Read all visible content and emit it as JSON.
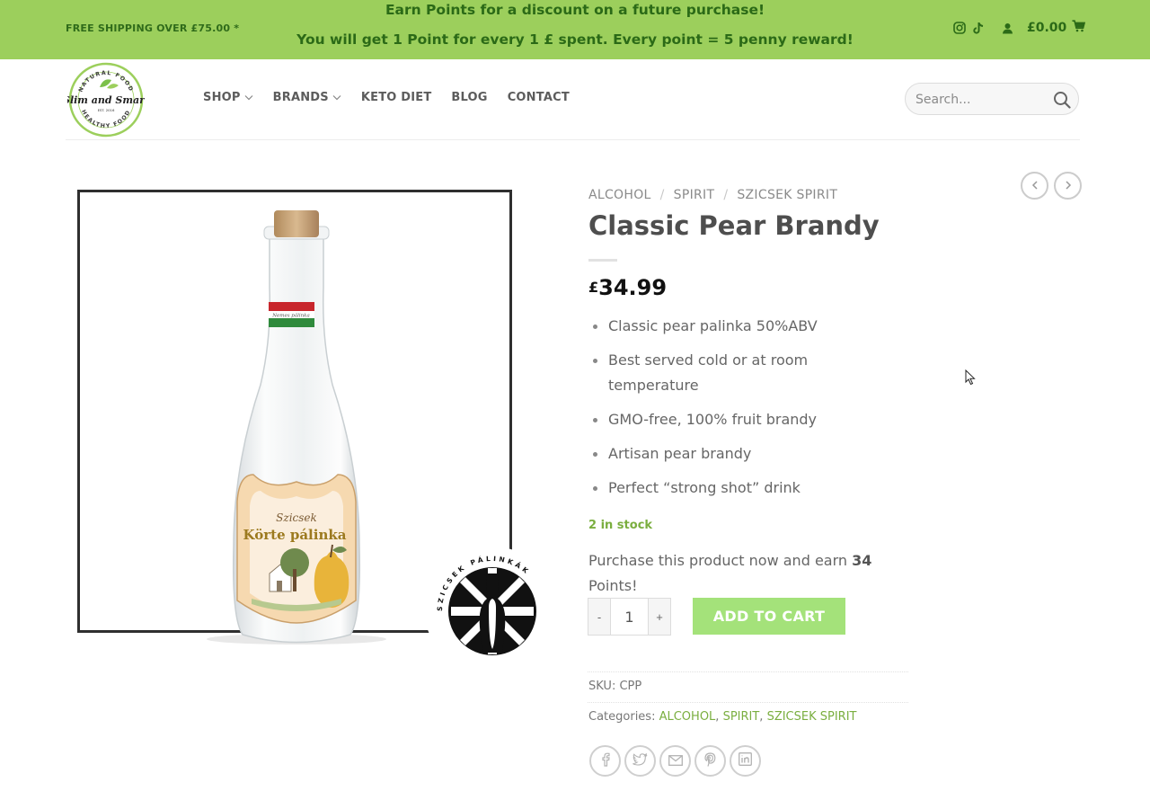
{
  "topbar": {
    "shipping": "FREE SHIPPING OVER £75.00 *",
    "promo_line1": "Earn Points for a discount on a future purchase!",
    "promo_line2": "You will get 1 Point for every 1 £ spent. Every point = 5 penny reward!",
    "cart_total": "£0.00",
    "icons": [
      "instagram-icon",
      "tiktok-icon",
      "user-icon",
      "cart-icon"
    ]
  },
  "header": {
    "logo_text": {
      "top": "NATURAL FOOD",
      "middle": "Slim and Smart",
      "est": "EST. 2016",
      "bottom": "HEALTHY FOOD"
    },
    "nav": [
      {
        "label": "SHOP",
        "dropdown": true
      },
      {
        "label": "BRANDS",
        "dropdown": true
      },
      {
        "label": "KETO DIET",
        "dropdown": false
      },
      {
        "label": "BLOG",
        "dropdown": false
      },
      {
        "label": "CONTACT",
        "dropdown": false
      }
    ],
    "search_placeholder": "Search..."
  },
  "product": {
    "breadcrumb": [
      "ALCOHOL",
      "SPIRIT",
      "SZICSEK SPIRIT"
    ],
    "title": "Classic Pear Brandy",
    "currency": "£",
    "price": "34.99",
    "features": [
      "Classic pear palinka 50%ABV",
      "Best served cold or at room temperature",
      "GMO-free, 100% fruit brandy",
      "Artisan pear brandy",
      "Perfect “strong shot” drink"
    ],
    "stock": "2 in stock",
    "earn_text_before": "Purchase this product now and earn ",
    "earn_points": "34",
    "earn_text_after": " Points!",
    "quantity": "1",
    "qty_minus": "-",
    "qty_plus": "+",
    "add_to_cart": "ADD TO CART",
    "sku_label": "SKU:",
    "sku_value": "CPP",
    "categories_label": "Categories:",
    "categories": [
      "ALCOHOL",
      "SPIRIT",
      "SZICSEK SPIRIT"
    ],
    "label_text": {
      "brand": "Szicsek",
      "name": "Körte pálinka",
      "band": "Nemes pálinka"
    },
    "share_icons": [
      "facebook-icon",
      "twitter-icon",
      "email-icon",
      "pinterest-icon",
      "linkedin-icon"
    ]
  },
  "badge_text": "SZICSEK PÁLINKÁK",
  "colors": {
    "topbar_bg": "#9ccf5c",
    "topbar_text": "#2b6a17",
    "accent_green": "#7aae3f",
    "add_to_cart_bg": "#a4e27a"
  }
}
